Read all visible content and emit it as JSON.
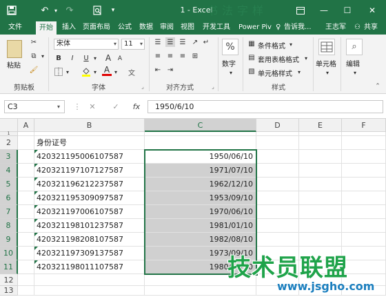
{
  "titlebar": {
    "title": "1 - Excel",
    "watermark": "书法字样"
  },
  "tabs": [
    {
      "label": "文件"
    },
    {
      "label": "开始"
    },
    {
      "label": "插入"
    },
    {
      "label": "页面布局"
    },
    {
      "label": "公式"
    },
    {
      "label": "数据"
    },
    {
      "label": "审阅"
    },
    {
      "label": "视图"
    },
    {
      "label": "开发工具"
    },
    {
      "label": "Power Piv"
    }
  ],
  "tell_me": "告诉我...",
  "user": "王志军",
  "share": "共享",
  "ribbon": {
    "clipboard": {
      "paste": "粘贴",
      "group": "剪贴板"
    },
    "font": {
      "name": "宋体",
      "size": "11",
      "group": "字体",
      "bold": "B",
      "italic": "I",
      "underline": "U",
      "font_color_glyph": "A",
      "grow": "A",
      "shrink": "A"
    },
    "alignment": {
      "group": "对齐方式"
    },
    "number": {
      "label": "数字"
    },
    "styles": {
      "conditional": "条件格式",
      "table": "套用表格格式",
      "cell": "单元格样式",
      "group": "样式"
    },
    "cells": {
      "label": "单元格"
    },
    "editing": {
      "label": "编辑"
    }
  },
  "formula_bar": {
    "name_box": "C3",
    "fx": "fx",
    "cancel": "✕",
    "enter": "✓",
    "value": "1950/6/10"
  },
  "sheet": {
    "columns": [
      "A",
      "B",
      "C",
      "D",
      "E",
      "F"
    ],
    "selected_column": "C",
    "rows": [
      "1",
      "2",
      "3",
      "4",
      "5",
      "6",
      "7",
      "8",
      "9",
      "10",
      "11",
      "12",
      "13"
    ],
    "header_b2": "身份证号",
    "ids": [
      "420321195006107587",
      "420321197107127587",
      "420321196212237587",
      "420321195309097587",
      "420321197006107587",
      "420321198101237587",
      "420321198208107587",
      "420321197309137587",
      "420321198011107587"
    ],
    "dates": [
      "1950/06/10",
      "1971/07/10",
      "1962/12/10",
      "1953/09/10",
      "1970/06/10",
      "1981/01/10",
      "1982/08/10",
      "1973/09/10",
      "1980/11/10"
    ]
  },
  "watermark": {
    "logo": "技术员联盟",
    "url": "www.jsgho.com"
  },
  "colors": {
    "excel_green": "#217346",
    "selection_fill": "#d0d0d0"
  }
}
